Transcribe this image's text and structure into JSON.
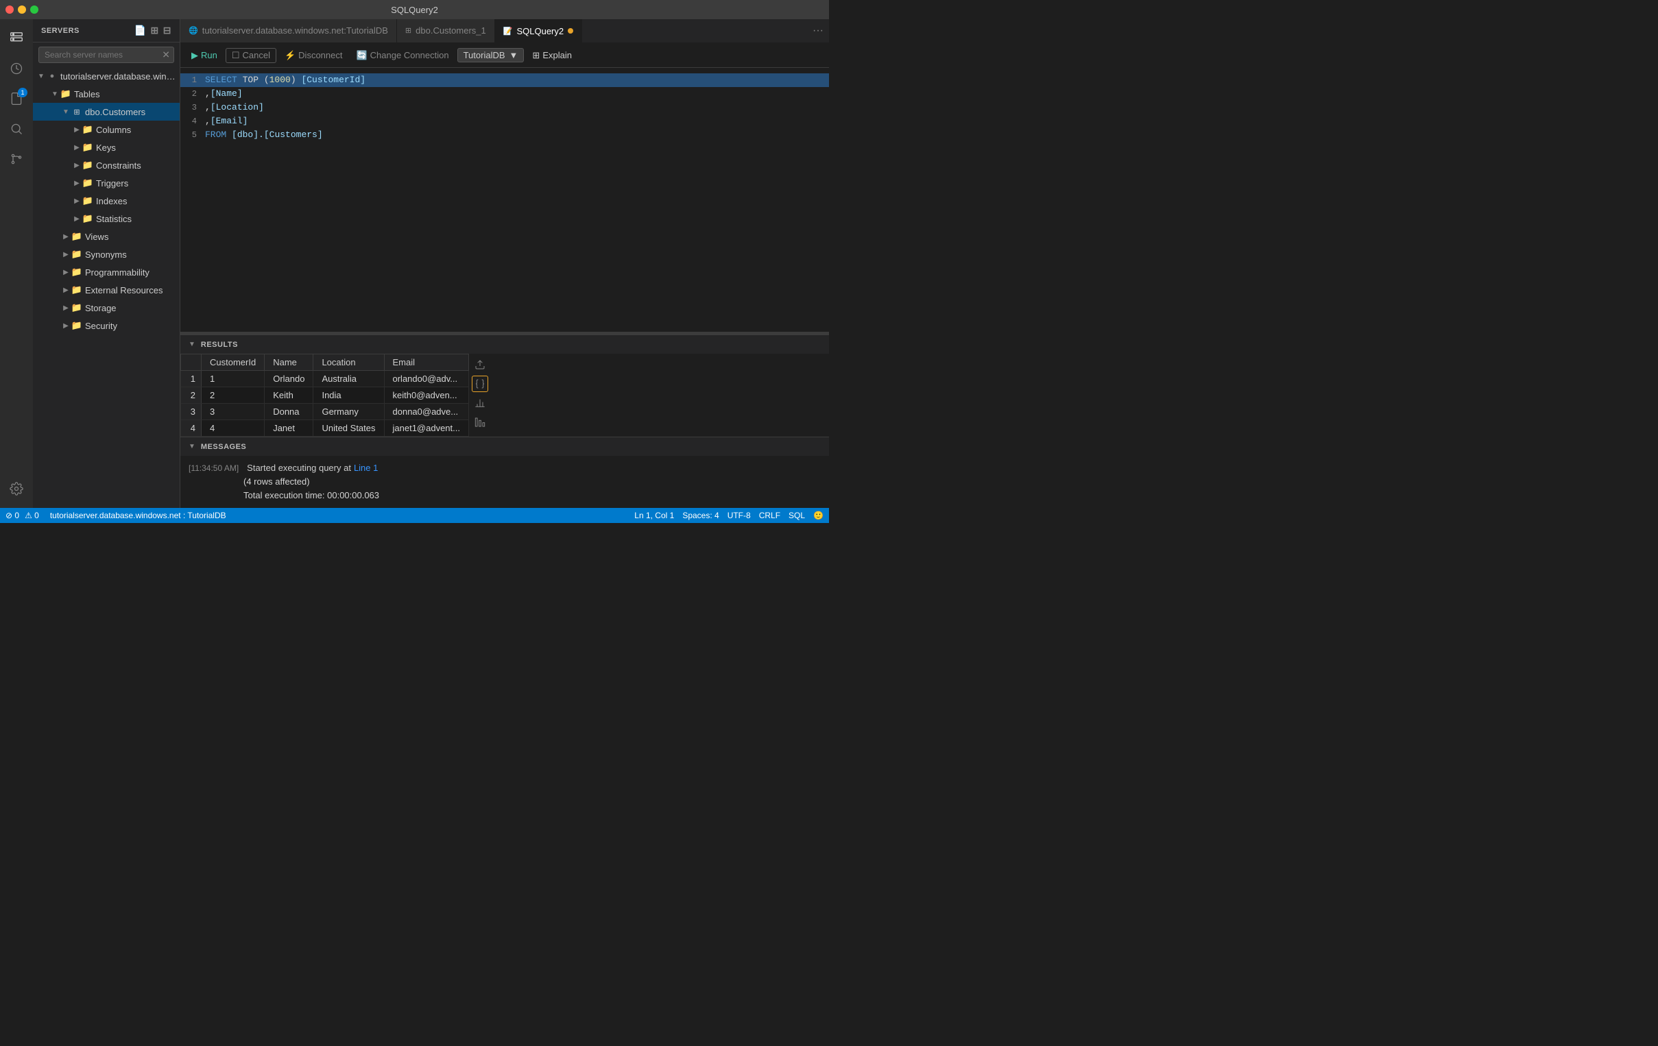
{
  "app": {
    "title": "SQLQuery2",
    "traffic_lights": [
      "close",
      "minimize",
      "maximize"
    ]
  },
  "activity_bar": {
    "icons": [
      {
        "name": "servers-icon",
        "symbol": "⊞",
        "active": false
      },
      {
        "name": "history-icon",
        "symbol": "⏱",
        "active": false
      },
      {
        "name": "files-icon",
        "symbol": "📄",
        "active": false,
        "badge": "1"
      },
      {
        "name": "search-icon",
        "symbol": "🔍",
        "active": false
      },
      {
        "name": "source-control-icon",
        "symbol": "⑂",
        "active": false
      },
      {
        "name": "settings-icon",
        "symbol": "⚙",
        "active": false
      }
    ]
  },
  "sidebar": {
    "header": "SERVERS",
    "search_placeholder": "Search server names",
    "tree": {
      "server_name": "tutorialserver.database.windows.n...",
      "tables_label": "Tables",
      "table_name": "dbo.Customers",
      "columns_label": "Columns",
      "keys_label": "Keys",
      "constraints_label": "Constraints",
      "triggers_label": "Triggers",
      "indexes_label": "Indexes",
      "statistics_label": "Statistics",
      "views_label": "Views",
      "synonyms_label": "Synonyms",
      "programmability_label": "Programmability",
      "external_resources_label": "External Resources",
      "storage_label": "Storage",
      "security_label": "Security"
    }
  },
  "tabs": [
    {
      "id": "tab-server",
      "label": "tutorialserver.database.windows.net:TutorialDB",
      "icon": "🌐",
      "active": false
    },
    {
      "id": "tab-customers",
      "label": "dbo.Customers_1",
      "icon": "📋",
      "active": false
    },
    {
      "id": "tab-query",
      "label": "SQLQuery2",
      "icon": "📝",
      "active": true,
      "dirty": true
    }
  ],
  "toolbar": {
    "run_label": "Run",
    "cancel_label": "Cancel",
    "disconnect_label": "Disconnect",
    "change_connection_label": "Change Connection",
    "database_name": "TutorialDB",
    "explain_label": "Explain"
  },
  "editor": {
    "lines": [
      {
        "num": 1,
        "tokens": [
          {
            "text": "SELECT",
            "class": "kw"
          },
          {
            "text": " TOP (",
            "class": "punct"
          },
          {
            "text": "1000",
            "class": "fn"
          },
          {
            "text": ")",
            "class": "punct"
          },
          {
            "text": " [CustomerId]",
            "class": "id"
          }
        ]
      },
      {
        "num": 2,
        "tokens": [
          {
            "text": "        ,[Name]",
            "class": "id"
          }
        ]
      },
      {
        "num": 3,
        "tokens": [
          {
            "text": "        ,[Location]",
            "class": "id"
          }
        ]
      },
      {
        "num": 4,
        "tokens": [
          {
            "text": "        ,[Email]",
            "class": "id"
          }
        ]
      },
      {
        "num": 5,
        "tokens": [
          {
            "text": "    FROM",
            "class": "kw"
          },
          {
            "text": " [dbo].[Customers]",
            "class": "id"
          }
        ]
      }
    ]
  },
  "results": {
    "section_label": "RESULTS",
    "columns": [
      "",
      "CustomerId",
      "Name",
      "Location",
      "Email"
    ],
    "rows": [
      {
        "row_num": 1,
        "customer_id": "1",
        "name": "Orlando",
        "location": "Australia",
        "email": "orlando0@adv..."
      },
      {
        "row_num": 2,
        "customer_id": "2",
        "name": "Keith",
        "location": "India",
        "email": "keith0@adven..."
      },
      {
        "row_num": 3,
        "customer_id": "3",
        "name": "Donna",
        "location": "Germany",
        "email": "donna0@adve..."
      },
      {
        "row_num": 4,
        "customer_id": "4",
        "name": "Janet",
        "location": "United States",
        "email": "janet1@advent..."
      }
    ],
    "side_icons": [
      "table-icon",
      "json-icon",
      "chart-icon",
      "bar-icon"
    ]
  },
  "messages": {
    "section_label": "MESSAGES",
    "time": "[11:34:50 AM]",
    "message_prefix": "Started executing query at",
    "link_text": "Line 1",
    "rows_affected": "(4 rows affected)",
    "execution_time": "Total execution time: 00:00:00.063"
  },
  "status_bar": {
    "server": "tutorialserver.database.windows.net : TutorialDB",
    "position": "Ln 1, Col 1",
    "spaces": "Spaces: 4",
    "encoding": "UTF-8",
    "line_ending": "CRLF",
    "language": "SQL",
    "smiley": "🙂",
    "errors": "⊘ 0",
    "warnings": "⚠ 0"
  }
}
